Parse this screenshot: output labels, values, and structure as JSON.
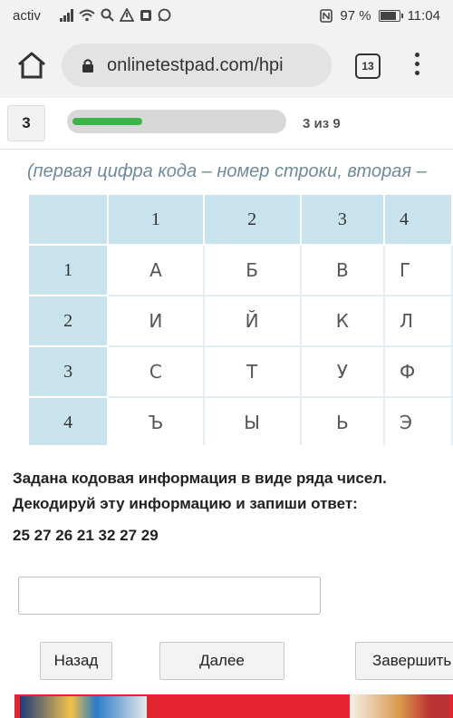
{
  "status": {
    "carrier": "activ",
    "battery": "97 %",
    "time": "11:04"
  },
  "browser": {
    "url": "onlinetestpad.com/hpi",
    "tab_count": "13"
  },
  "quiz": {
    "question_number": "3",
    "progress_text": "3 из 9",
    "progress_fraction": 0.333,
    "hint": "(первая цифра кода – номер строки, вторая –",
    "table": {
      "columns": [
        "1",
        "2",
        "3",
        "4"
      ],
      "rows": [
        {
          "label": "1",
          "cells": [
            "А",
            "Б",
            "В",
            "Г"
          ]
        },
        {
          "label": "2",
          "cells": [
            "И",
            "Й",
            "К",
            "Л"
          ]
        },
        {
          "label": "3",
          "cells": [
            "С",
            "Т",
            "У",
            "Ф"
          ]
        },
        {
          "label": "4",
          "cells": [
            "Ъ",
            "Ы",
            "Ь",
            "Э"
          ]
        }
      ]
    },
    "question_line1": "Задана кодовая информация в виде ряда чисел.",
    "question_line2": "Декодируй эту информацию и запиши ответ:",
    "sequence": "25 27 26 21 32 27 29",
    "answer_value": ""
  },
  "buttons": {
    "back": "Назад",
    "next": "Далее",
    "finish": "Завершить"
  }
}
